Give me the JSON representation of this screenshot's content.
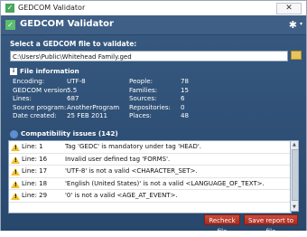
{
  "window": {
    "title": "GEDCOM Validator",
    "close_label": "✕"
  },
  "header": {
    "title": "GEDCOM Validator",
    "gear_glyph": "✱",
    "gear_caret": "▾",
    "icon_glyph": "✓"
  },
  "file_select": {
    "label": "Select a GEDCOM file to validate:",
    "path": "C:\\Users\\Public\\Whitehead Family.ged"
  },
  "file_info": {
    "title": "File information",
    "rows": [
      {
        "k1": "Encoding:",
        "v1": "UTF-8",
        "k2": "People:",
        "v2": "78"
      },
      {
        "k1": "GEDCOM version:",
        "v1": "5.5",
        "k2": "Families:",
        "v2": "15"
      },
      {
        "k1": "Lines:",
        "v1": "687",
        "k2": "Sources:",
        "v2": "6"
      },
      {
        "k1": "Source program:",
        "v1": "AnotherProgram",
        "k2": "Repositories:",
        "v2": "0"
      },
      {
        "k1": "Date created:",
        "v1": "25 FEB 2011",
        "k2": "Places:",
        "v2": "48"
      }
    ]
  },
  "compat": {
    "title": "Compatibility issues (142)",
    "issues": [
      {
        "line": "Line: 1",
        "msg": "Tag 'GEDC' is mandatory under tag 'HEAD'."
      },
      {
        "line": "Line: 16",
        "msg": "Invalid user defined tag 'FORMS'."
      },
      {
        "line": "Line: 17",
        "msg": "'UTF-8' is not a valid <CHARACTER_SET>."
      },
      {
        "line": "Line: 18",
        "msg": "'English (United States)' is not a valid <LANGUAGE_OF_TEXT>."
      },
      {
        "line": "Line: 29",
        "msg": "'0' is not a valid <AGE_AT_EVENT>."
      }
    ]
  },
  "buttons": {
    "recheck": "Recheck file",
    "save": "Save report to file"
  },
  "colors": {
    "panel": "#2f5078",
    "button": "#b93a2d",
    "warning": "#f2c12e"
  }
}
